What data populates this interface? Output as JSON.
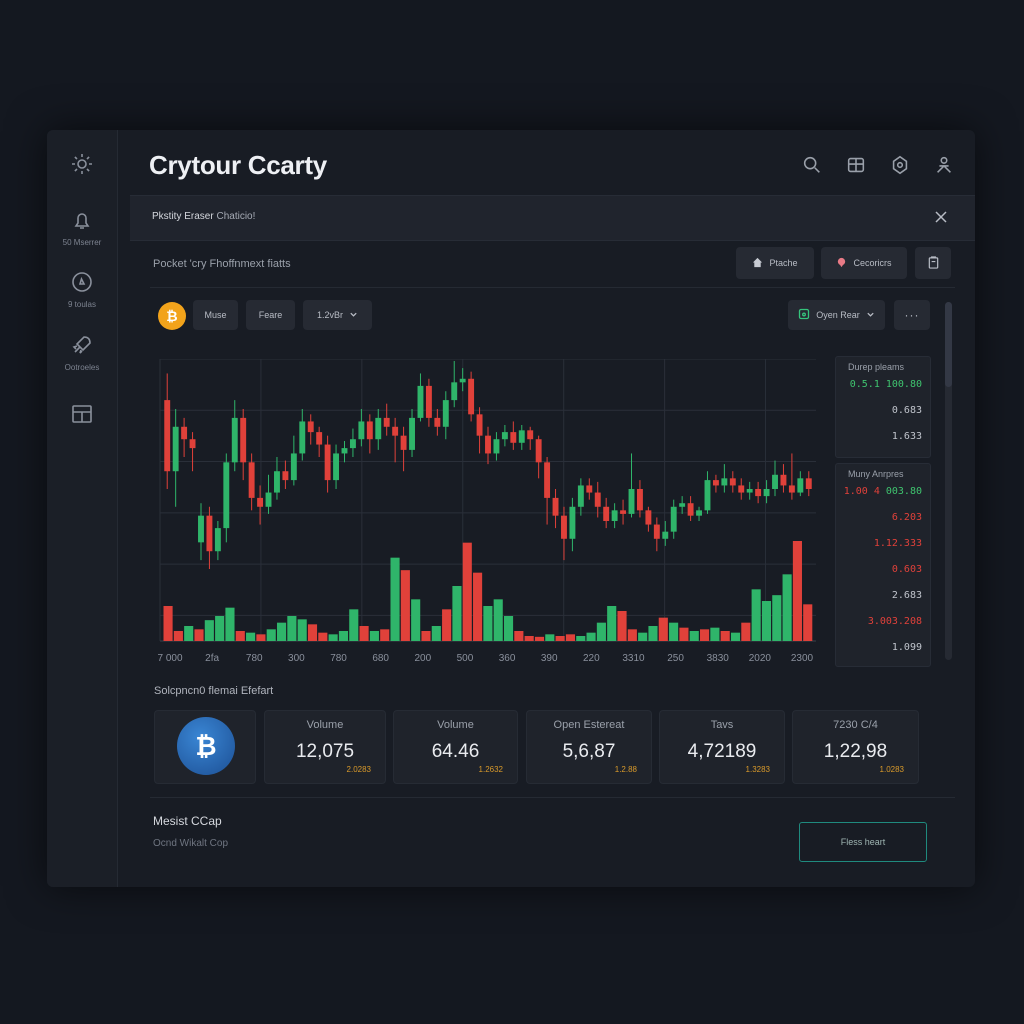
{
  "app": {
    "title": "Crytour Ccarty"
  },
  "sidebar": {
    "items": [
      {
        "icon": "gear-icon",
        "label": ""
      },
      {
        "icon": "bell-icon",
        "label": "50 Mserrer"
      },
      {
        "icon": "compass-icon",
        "label": "9 toulas"
      },
      {
        "icon": "rocket-icon",
        "label": "Ootroeles"
      },
      {
        "icon": "grid-icon",
        "label": ""
      }
    ]
  },
  "header": {
    "icons": [
      "search-icon",
      "box-icon",
      "badge-icon",
      "user-icon"
    ]
  },
  "banner": {
    "title": "Pkstity Eraser",
    "subtitle": "Chaticio!"
  },
  "subheader": {
    "text": "Pocket 'cry Fhoffnmext fiatts",
    "buttons": [
      {
        "label": "Ptache",
        "icon": "home-icon"
      },
      {
        "label": "Cecoricrs",
        "icon": "pin-icon"
      }
    ],
    "icon_button": "clipboard-icon"
  },
  "toolbar": {
    "coin_symbol": "₿",
    "buttons": [
      "Muse",
      "Feare",
      "1.2vBr"
    ],
    "open_label": "Oyen Rear",
    "more_label": "···"
  },
  "chart_data": {
    "type": "candlestick",
    "x_tick_labels": [
      "7 000",
      "2fa",
      "780",
      "300",
      "780",
      "680",
      "200",
      "500",
      "360",
      "390",
      "220",
      "3310",
      "250",
      "3830",
      "2020",
      "2300"
    ],
    "candles": [
      {
        "o": 140,
        "c": 100,
        "h": 155,
        "l": 90
      },
      {
        "o": 100,
        "c": 125,
        "h": 135,
        "l": 80
      },
      {
        "o": 125,
        "c": 118,
        "h": 130,
        "l": 108
      },
      {
        "o": 118,
        "c": 113,
        "h": 122,
        "l": 100
      },
      {
        "o": 60,
        "c": 75,
        "h": 82,
        "l": 50
      },
      {
        "o": 75,
        "c": 55,
        "h": 80,
        "l": 45
      },
      {
        "o": 55,
        "c": 68,
        "h": 72,
        "l": 50
      },
      {
        "o": 68,
        "c": 105,
        "h": 110,
        "l": 60
      },
      {
        "o": 105,
        "c": 130,
        "h": 140,
        "l": 100
      },
      {
        "o": 130,
        "c": 105,
        "h": 135,
        "l": 95
      },
      {
        "o": 105,
        "c": 85,
        "h": 110,
        "l": 78
      },
      {
        "o": 85,
        "c": 80,
        "h": 92,
        "l": 70
      },
      {
        "o": 80,
        "c": 88,
        "h": 98,
        "l": 76
      },
      {
        "o": 88,
        "c": 100,
        "h": 108,
        "l": 84
      },
      {
        "o": 100,
        "c": 95,
        "h": 106,
        "l": 90
      },
      {
        "o": 95,
        "c": 110,
        "h": 120,
        "l": 92
      },
      {
        "o": 110,
        "c": 128,
        "h": 135,
        "l": 106
      },
      {
        "o": 128,
        "c": 122,
        "h": 132,
        "l": 115
      },
      {
        "o": 122,
        "c": 115,
        "h": 125,
        "l": 108
      },
      {
        "o": 115,
        "c": 95,
        "h": 120,
        "l": 88
      },
      {
        "o": 95,
        "c": 110,
        "h": 115,
        "l": 90
      },
      {
        "o": 110,
        "c": 113,
        "h": 117,
        "l": 105
      },
      {
        "o": 113,
        "c": 118,
        "h": 124,
        "l": 108
      },
      {
        "o": 118,
        "c": 128,
        "h": 135,
        "l": 114
      },
      {
        "o": 128,
        "c": 118,
        "h": 132,
        "l": 110
      },
      {
        "o": 118,
        "c": 130,
        "h": 135,
        "l": 112
      },
      {
        "o": 130,
        "c": 125,
        "h": 138,
        "l": 120
      },
      {
        "o": 125,
        "c": 120,
        "h": 130,
        "l": 105
      },
      {
        "o": 120,
        "c": 112,
        "h": 125,
        "l": 100
      },
      {
        "o": 112,
        "c": 130,
        "h": 135,
        "l": 108
      },
      {
        "o": 130,
        "c": 148,
        "h": 155,
        "l": 128
      },
      {
        "o": 148,
        "c": 130,
        "h": 152,
        "l": 125
      },
      {
        "o": 130,
        "c": 125,
        "h": 135,
        "l": 120
      },
      {
        "o": 125,
        "c": 140,
        "h": 145,
        "l": 118
      },
      {
        "o": 140,
        "c": 150,
        "h": 162,
        "l": 136
      },
      {
        "o": 150,
        "c": 152,
        "h": 158,
        "l": 145
      },
      {
        "o": 152,
        "c": 132,
        "h": 156,
        "l": 128
      },
      {
        "o": 132,
        "c": 120,
        "h": 136,
        "l": 110
      },
      {
        "o": 120,
        "c": 110,
        "h": 125,
        "l": 104
      },
      {
        "o": 110,
        "c": 118,
        "h": 122,
        "l": 106
      },
      {
        "o": 118,
        "c": 122,
        "h": 126,
        "l": 114
      },
      {
        "o": 122,
        "c": 116,
        "h": 128,
        "l": 112
      },
      {
        "o": 116,
        "c": 123,
        "h": 126,
        "l": 112
      },
      {
        "o": 123,
        "c": 118,
        "h": 125,
        "l": 112
      },
      {
        "o": 118,
        "c": 105,
        "h": 120,
        "l": 96
      },
      {
        "o": 105,
        "c": 85,
        "h": 108,
        "l": 70
      },
      {
        "o": 85,
        "c": 75,
        "h": 90,
        "l": 68
      },
      {
        "o": 75,
        "c": 62,
        "h": 80,
        "l": 50
      },
      {
        "o": 62,
        "c": 80,
        "h": 85,
        "l": 55
      },
      {
        "o": 80,
        "c": 92,
        "h": 96,
        "l": 75
      },
      {
        "o": 92,
        "c": 88,
        "h": 96,
        "l": 84
      },
      {
        "o": 88,
        "c": 80,
        "h": 94,
        "l": 74
      },
      {
        "o": 80,
        "c": 72,
        "h": 85,
        "l": 68
      },
      {
        "o": 72,
        "c": 78,
        "h": 82,
        "l": 68
      },
      {
        "o": 78,
        "c": 76,
        "h": 84,
        "l": 70
      },
      {
        "o": 76,
        "c": 90,
        "h": 110,
        "l": 74
      },
      {
        "o": 90,
        "c": 78,
        "h": 95,
        "l": 74
      },
      {
        "o": 78,
        "c": 70,
        "h": 80,
        "l": 66
      },
      {
        "o": 70,
        "c": 62,
        "h": 74,
        "l": 55
      },
      {
        "o": 62,
        "c": 66,
        "h": 72,
        "l": 58
      },
      {
        "o": 66,
        "c": 80,
        "h": 84,
        "l": 62
      },
      {
        "o": 80,
        "c": 82,
        "h": 86,
        "l": 76
      },
      {
        "o": 82,
        "c": 75,
        "h": 86,
        "l": 72
      },
      {
        "o": 75,
        "c": 78,
        "h": 80,
        "l": 72
      },
      {
        "o": 78,
        "c": 95,
        "h": 100,
        "l": 76
      },
      {
        "o": 95,
        "c": 92,
        "h": 98,
        "l": 88
      },
      {
        "o": 92,
        "c": 96,
        "h": 104,
        "l": 88
      },
      {
        "o": 96,
        "c": 92,
        "h": 100,
        "l": 88
      },
      {
        "o": 92,
        "c": 88,
        "h": 96,
        "l": 84
      },
      {
        "o": 88,
        "c": 90,
        "h": 94,
        "l": 84
      },
      {
        "o": 90,
        "c": 86,
        "h": 94,
        "l": 82
      },
      {
        "o": 86,
        "c": 90,
        "h": 95,
        "l": 82
      },
      {
        "o": 90,
        "c": 98,
        "h": 106,
        "l": 86
      },
      {
        "o": 98,
        "c": 92,
        "h": 104,
        "l": 88
      },
      {
        "o": 92,
        "c": 88,
        "h": 110,
        "l": 84
      },
      {
        "o": 88,
        "c": 96,
        "h": 100,
        "l": 86
      },
      {
        "o": 96,
        "c": 90,
        "h": 100,
        "l": 86
      }
    ],
    "volumes": [
      {
        "v": 42,
        "d": "down"
      },
      {
        "v": 12,
        "d": "down"
      },
      {
        "v": 18,
        "d": "up"
      },
      {
        "v": 14,
        "d": "down"
      },
      {
        "v": 25,
        "d": "up"
      },
      {
        "v": 30,
        "d": "up"
      },
      {
        "v": 40,
        "d": "up"
      },
      {
        "v": 12,
        "d": "down"
      },
      {
        "v": 10,
        "d": "up"
      },
      {
        "v": 8,
        "d": "down"
      },
      {
        "v": 14,
        "d": "up"
      },
      {
        "v": 22,
        "d": "up"
      },
      {
        "v": 30,
        "d": "up"
      },
      {
        "v": 26,
        "d": "up"
      },
      {
        "v": 20,
        "d": "down"
      },
      {
        "v": 10,
        "d": "down"
      },
      {
        "v": 8,
        "d": "up"
      },
      {
        "v": 12,
        "d": "up"
      },
      {
        "v": 38,
        "d": "up"
      },
      {
        "v": 18,
        "d": "down"
      },
      {
        "v": 12,
        "d": "up"
      },
      {
        "v": 14,
        "d": "down"
      },
      {
        "v": 100,
        "d": "up"
      },
      {
        "v": 85,
        "d": "down"
      },
      {
        "v": 50,
        "d": "up"
      },
      {
        "v": 12,
        "d": "down"
      },
      {
        "v": 18,
        "d": "up"
      },
      {
        "v": 38,
        "d": "down"
      },
      {
        "v": 66,
        "d": "up"
      },
      {
        "v": 118,
        "d": "down"
      },
      {
        "v": 82,
        "d": "down"
      },
      {
        "v": 42,
        "d": "up"
      },
      {
        "v": 50,
        "d": "up"
      },
      {
        "v": 30,
        "d": "up"
      },
      {
        "v": 12,
        "d": "down"
      },
      {
        "v": 6,
        "d": "down"
      },
      {
        "v": 5,
        "d": "down"
      },
      {
        "v": 8,
        "d": "up"
      },
      {
        "v": 6,
        "d": "down"
      },
      {
        "v": 8,
        "d": "down"
      },
      {
        "v": 6,
        "d": "up"
      },
      {
        "v": 10,
        "d": "up"
      },
      {
        "v": 22,
        "d": "up"
      },
      {
        "v": 42,
        "d": "up"
      },
      {
        "v": 36,
        "d": "down"
      },
      {
        "v": 14,
        "d": "down"
      },
      {
        "v": 10,
        "d": "up"
      },
      {
        "v": 18,
        "d": "up"
      },
      {
        "v": 28,
        "d": "down"
      },
      {
        "v": 22,
        "d": "up"
      },
      {
        "v": 16,
        "d": "down"
      },
      {
        "v": 12,
        "d": "up"
      },
      {
        "v": 14,
        "d": "down"
      },
      {
        "v": 16,
        "d": "up"
      },
      {
        "v": 12,
        "d": "down"
      },
      {
        "v": 10,
        "d": "up"
      },
      {
        "v": 22,
        "d": "down"
      },
      {
        "v": 62,
        "d": "up"
      },
      {
        "v": 48,
        "d": "up"
      },
      {
        "v": 55,
        "d": "up"
      },
      {
        "v": 80,
        "d": "up"
      },
      {
        "v": 120,
        "d": "down"
      },
      {
        "v": 44,
        "d": "down"
      }
    ],
    "grid": true,
    "up_color": "#2fb56a",
    "down_color": "#e0413a"
  },
  "panels": {
    "top": {
      "title": "Durep pleams",
      "values": [
        {
          "text": "0.5.1 100.80",
          "color": "#3fc46f"
        },
        {
          "text": "0.683",
          "color": "#c0c4cc"
        },
        {
          "text": "1.633",
          "color": "#c0c4cc"
        }
      ]
    },
    "bottom": {
      "title": "Muny Anrpres",
      "values": [
        {
          "text": "1.00 4 003.80",
          "color": "mixed"
        },
        {
          "text": "6.203",
          "color": "#e0413a"
        },
        {
          "text": "1.12.333",
          "color": "#e0413a"
        },
        {
          "text": "0.603",
          "color": "#e0413a"
        },
        {
          "text": "2.683",
          "color": "#c0c4cc"
        },
        {
          "text": "3.003.208",
          "color": "#e0413a"
        },
        {
          "text": "1.099",
          "color": "#c0c4cc"
        }
      ]
    }
  },
  "stats": {
    "title": "Solcpncn0 flemai Efefart",
    "cards": [
      {
        "label": "Volume",
        "value": "12,075",
        "sub": "2.0283"
      },
      {
        "label": "Volume",
        "value": "64.46",
        "sub": "1.2632"
      },
      {
        "label": "Open Estereat",
        "value": "5,6,87",
        "sub": "1.2.88"
      },
      {
        "label": "Tavs",
        "value": "4,72189",
        "sub": "1.3283"
      },
      {
        "label": "7230 C/4",
        "value": "1,22,98",
        "sub": "1.0283"
      }
    ]
  },
  "market": {
    "title": "Mesist CCap",
    "subtitle": "Ocnd Wikalt Cop",
    "button_label": "Fless heart"
  }
}
